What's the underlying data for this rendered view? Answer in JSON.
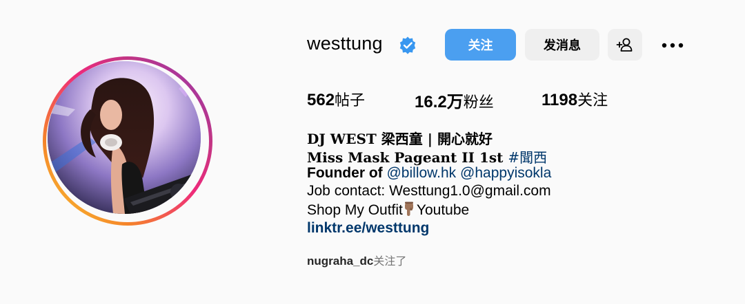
{
  "profile": {
    "username": "westtung",
    "verified": true,
    "avatar_alt": "avatar",
    "actions": {
      "follow_label": "关注",
      "message_label": "发消息",
      "suggest_icon": "person-add-icon",
      "more_icon": "more-horizontal-icon"
    },
    "stats": {
      "posts_count": "562",
      "posts_label": "帖子",
      "followers_count": "16.2万",
      "followers_label": "粉丝",
      "following_count": "1198",
      "following_label": "关注"
    },
    "bio": {
      "name": "DJ WEST 梁西童 | 開心就好",
      "title_text": "Miss Mask Pageant II 1st ",
      "title_hashtag": "#聞西",
      "founder_prefix": "Founder of ",
      "founder_link1": "@billow.hk",
      "founder_sep": " ",
      "founder_link2": "@happyisokla",
      "contact": "Job contact: Westtung1.0@gmail.com",
      "shop_prefix": "Shop My Outfit",
      "shop_icon": "pointing-down-hand-icon",
      "shop_suffix": "Youtube",
      "link": "linktr.ee/westtung"
    },
    "followed_by": {
      "name": "nugraha_dc",
      "suffix": "关注了"
    },
    "colors": {
      "follow_button": "#4b9ff0",
      "secondary_button": "#efefef",
      "link": "#00376b",
      "verified_badge": "#3897f0",
      "background": "#fafafa"
    }
  }
}
